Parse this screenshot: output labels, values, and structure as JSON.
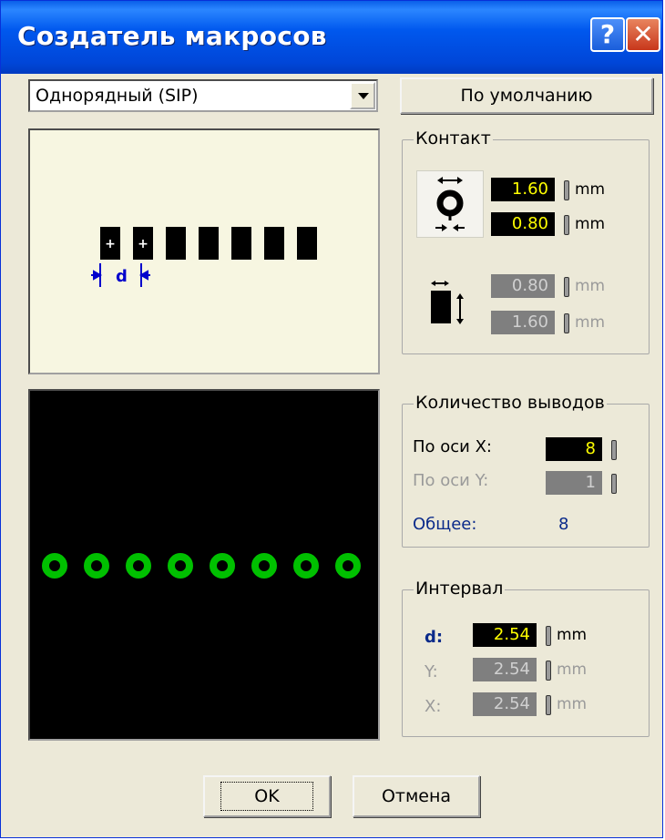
{
  "window": {
    "title": "Создатель макросов",
    "help": "?",
    "close": "✕"
  },
  "type_select": {
    "value": "Однорядный (SIP)"
  },
  "default_button": "По умолчанию",
  "preview_top": {
    "pad_count": 7,
    "marked_pads": 2,
    "plus": "+",
    "d_label": "d"
  },
  "preview_bottom": {
    "pin_count": 8,
    "pin_color": "#00c000"
  },
  "contact": {
    "title": "Контакт",
    "hole_outer": "1.60",
    "hole_inner": "0.80",
    "pad_width": "0.80",
    "pad_height": "1.60",
    "unit": "mm"
  },
  "pins": {
    "title": "Количество выводов",
    "x_label": "По оси X:",
    "x_value": "8",
    "y_label": "По оси Y:",
    "y_value": "1",
    "total_label": "Общее:",
    "total_value": "8"
  },
  "interval": {
    "title": "Интервал",
    "d_label": "d:",
    "d_value": "2.54",
    "y_label": "Y:",
    "y_value": "2.54",
    "x_label": "X:",
    "x_value": "2.54",
    "unit": "mm"
  },
  "buttons": {
    "ok": "OK",
    "cancel": "Отмена"
  },
  "colors": {
    "title_blue": "#0058ee",
    "field_active": "#000000",
    "value_yellow": "#ffff00",
    "accent_label": "#0a2a8a"
  }
}
